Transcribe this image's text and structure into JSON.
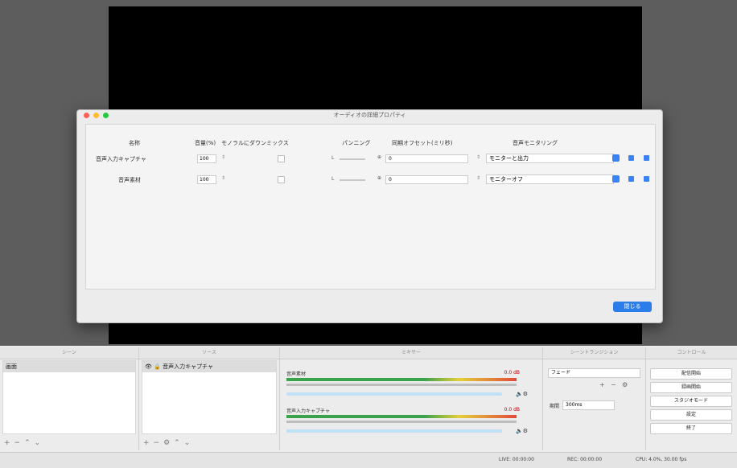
{
  "dialog": {
    "title": "オーディオの詳細プロパティ",
    "headers": {
      "name": "名称",
      "volume": "音量(%)",
      "downmix": "モノラルにダウンミックス",
      "balance": "パンニング",
      "sync": "同期オフセット(ミリ秒)",
      "monitoring": "音声モニタリング"
    },
    "rows": [
      {
        "name": "音声入力キャプチャ",
        "volume": "100",
        "pan_left": "L",
        "sync": "0",
        "monitoring": "モニターと出力"
      },
      {
        "name": "音声素材",
        "volume": "100",
        "pan_left": "L",
        "sync": "0",
        "monitoring": "モニターオフ"
      }
    ],
    "close_label": "閉じる"
  },
  "docks": {
    "scenes": {
      "title": "シーン",
      "items": [
        "画面"
      ]
    },
    "sources": {
      "title": "ソース",
      "items": [
        "音声入力キャプチャ"
      ]
    },
    "mixer": {
      "title": "ミキサー",
      "channels": [
        {
          "name": "音声素材",
          "db": "0.0 dB"
        },
        {
          "name": "音声入力キャプチャ",
          "db": "0.0 dB"
        }
      ]
    },
    "transitions": {
      "title": "シーントランジション",
      "selected": "フェード",
      "duration_label": "期間",
      "duration_value": "300ms"
    },
    "controls": {
      "title": "コントロール",
      "buttons": [
        "配信開始",
        "録画開始",
        "スタジオモード",
        "設定",
        "終了"
      ]
    }
  },
  "status": {
    "live": "LIVE: 00:00:00",
    "rec": "REC: 00:00:00",
    "cpu": "CPU: 4.0%, 30.00 fps"
  }
}
